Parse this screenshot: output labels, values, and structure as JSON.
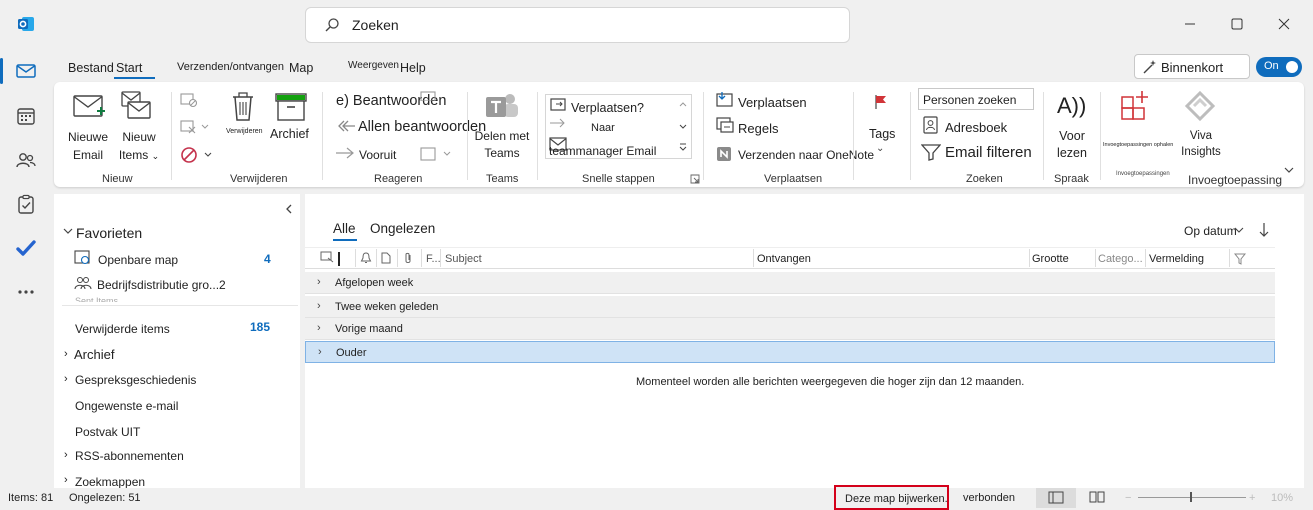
{
  "colors": {
    "accent": "#0f6cbd",
    "selected_row": "#cfe3f6",
    "highlight_box": "#d4001a"
  },
  "titlebar": {
    "app_icon": "outlook-icon",
    "search_placeholder": "Zoeken"
  },
  "nav_rail": [
    "mail-icon",
    "calendar-icon",
    "people-icon",
    "tasks-icon",
    "todo-icon",
    "more-icon"
  ],
  "menu": {
    "tabs": [
      "Bestand",
      "Start",
      "Verzenden/ontvangen",
      "Map",
      "Weergeven",
      "Help"
    ],
    "active": "Start",
    "binnenkort": "Binnenkort",
    "toggle": "On"
  },
  "ribbon": {
    "nieuw": {
      "new_email": [
        "Nieuwe",
        "Email"
      ],
      "new_items": [
        "Nieuw",
        "Items"
      ],
      "group": "Nieuw"
    },
    "verwijderen": {
      "delete": "Verwijderen",
      "archive": "Archief",
      "group": "Verwijderen"
    },
    "reageren": {
      "reply": "e) Beantwoorden",
      "reply_all": "Allen beantwoorden",
      "forward": "Vooruit",
      "group": "Reageren"
    },
    "teams": {
      "share": [
        "Delen met",
        "Teams"
      ],
      "group": "Teams"
    },
    "quick_steps": {
      "items": [
        "Verplaatsen?",
        "Naar",
        "teammanager Email"
      ],
      "group": "Snelle stappen"
    },
    "verplaatsen": {
      "move": "Verplaatsen",
      "rules": "Regels",
      "onenote": "Verzenden naar OneNote",
      "group": "Verplaatsen"
    },
    "tags": {
      "label": "Tags"
    },
    "zoeken": {
      "people": "Personen zoeken",
      "address_book": "Adresboek",
      "filter": "Email filteren",
      "group": "Zoeken"
    },
    "spraak": {
      "icon_text": "A))",
      "read_aloud": [
        "Voor",
        "lezen"
      ],
      "group": "Spraak"
    },
    "invoeg": {
      "get_addins": "Invoegtoepassingen ophalen",
      "group_small": "Invoegtoepassingen",
      "viva": [
        "Viva",
        "Insights"
      ],
      "group": "Invoegtoepassing"
    }
  },
  "folders": {
    "favorites": "Favorieten",
    "items": [
      {
        "label": "Openbare map",
        "count": "4"
      },
      {
        "label": "Bedrijfsdistributie gro...2",
        "count": ""
      },
      {
        "label": "Sent Items",
        "count": ""
      },
      {
        "label": "Verwijderde items",
        "count": "185"
      },
      {
        "label": "Archief",
        "count": ""
      },
      {
        "label": "Gespreksgeschiedenis",
        "count": ""
      },
      {
        "label": "Ongewenste e-mail",
        "count": ""
      },
      {
        "label": "Postvak UIT",
        "count": ""
      },
      {
        "label": "RSS-abonnementen",
        "count": ""
      },
      {
        "label": "Zoekmappen",
        "count": ""
      }
    ]
  },
  "message_list": {
    "tabs": [
      "Alle",
      "Ongelezen"
    ],
    "sort": "Op datum",
    "columns": [
      "F...",
      "Subject",
      "Ontvangen",
      "Grootte",
      "Catego...",
      "Vermelding"
    ],
    "groups": [
      "Afgelopen week",
      "Twee weken geleden",
      "Vorige maand",
      "Ouder"
    ],
    "selected_group": "Ouder",
    "info": "Momenteel worden alle berichten weergegeven die hoger zijn dan 12 maanden."
  },
  "status": {
    "items": "Items: 81",
    "unread": "Ongelezen: 51",
    "update": "Deze map bijwerken.",
    "connection": "verbonden",
    "zoom": "10%"
  }
}
